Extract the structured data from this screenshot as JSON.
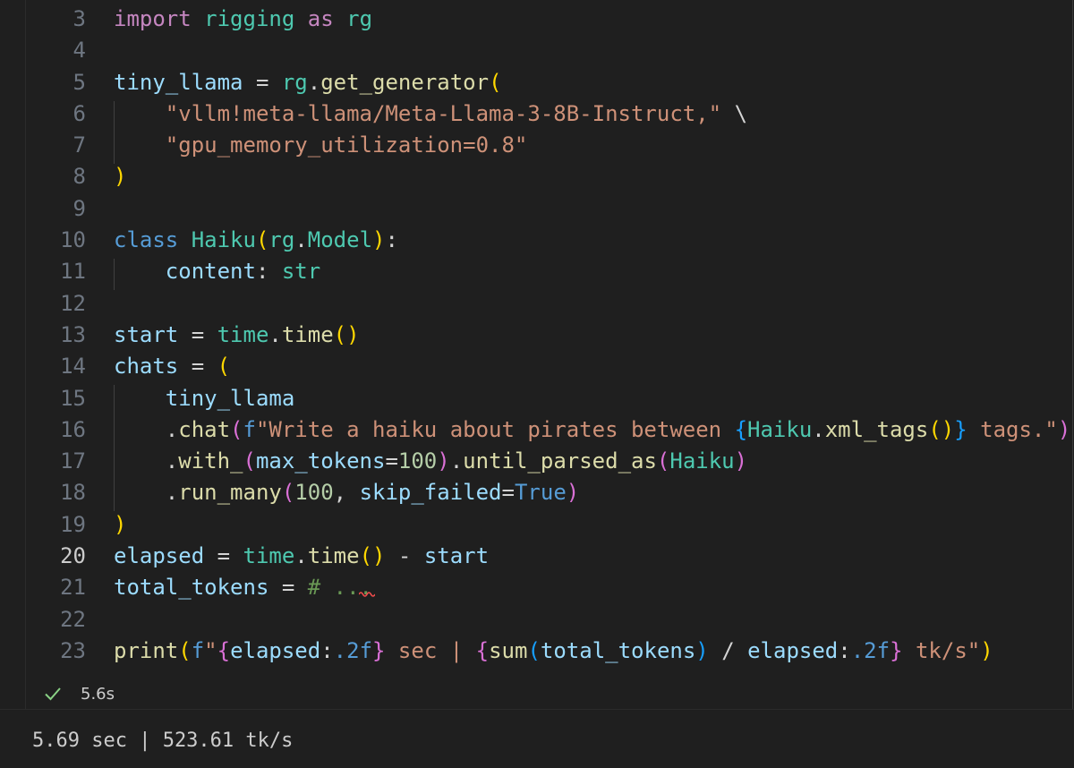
{
  "editor": {
    "line_numbers": [
      "3",
      "4",
      "5",
      "6",
      "7",
      "8",
      "9",
      "10",
      "11",
      "12",
      "13",
      "14",
      "15",
      "16",
      "17",
      "18",
      "19",
      "20",
      "21",
      "22",
      "23"
    ],
    "active_line": "20",
    "lines": [
      [
        [
          "kw",
          "import"
        ],
        [
          "op",
          " "
        ],
        [
          "cls",
          "rigging"
        ],
        [
          "op",
          " "
        ],
        [
          "kw",
          "as"
        ],
        [
          "op",
          " "
        ],
        [
          "cls",
          "rg"
        ]
      ],
      [],
      [
        [
          "var",
          "tiny_llama"
        ],
        [
          "op",
          " = "
        ],
        [
          "cls",
          "rg"
        ],
        [
          "op",
          "."
        ],
        [
          "fn",
          "get_generator"
        ],
        [
          "p1",
          "("
        ]
      ],
      [
        [
          "op",
          "    "
        ],
        [
          "str",
          "\"vllm!meta-llama/Meta-Llama-3-8B-Instruct,\""
        ],
        [
          "op",
          " \\"
        ]
      ],
      [
        [
          "op",
          "    "
        ],
        [
          "str",
          "\"gpu_memory_utilization=0.8\""
        ]
      ],
      [
        [
          "p1",
          ")"
        ]
      ],
      [],
      [
        [
          "kw2",
          "class"
        ],
        [
          "op",
          " "
        ],
        [
          "cls",
          "Haiku"
        ],
        [
          "p1",
          "("
        ],
        [
          "cls",
          "rg"
        ],
        [
          "op",
          "."
        ],
        [
          "cls",
          "Model"
        ],
        [
          "p1",
          ")"
        ],
        [
          "op",
          ":"
        ]
      ],
      [
        [
          "op",
          "    "
        ],
        [
          "var",
          "content"
        ],
        [
          "op",
          ": "
        ],
        [
          "cls",
          "str"
        ]
      ],
      [],
      [
        [
          "var",
          "start"
        ],
        [
          "op",
          " = "
        ],
        [
          "cls",
          "time"
        ],
        [
          "op",
          "."
        ],
        [
          "fn",
          "time"
        ],
        [
          "p1",
          "()"
        ]
      ],
      [
        [
          "var",
          "chats"
        ],
        [
          "op",
          " = "
        ],
        [
          "p1",
          "("
        ]
      ],
      [
        [
          "op",
          "    "
        ],
        [
          "var",
          "tiny_llama"
        ]
      ],
      [
        [
          "op",
          "    ."
        ],
        [
          "fn",
          "chat"
        ],
        [
          "p2",
          "("
        ],
        [
          "kw2",
          "f"
        ],
        [
          "str",
          "\"Write a haiku about pirates between "
        ],
        [
          "p3",
          "{"
        ],
        [
          "cls",
          "Haiku"
        ],
        [
          "op",
          "."
        ],
        [
          "fn",
          "xml_tags"
        ],
        [
          "p1",
          "()"
        ],
        [
          "p3",
          "}"
        ],
        [
          "str",
          " tags.\""
        ],
        [
          "p2",
          ")"
        ]
      ],
      [
        [
          "op",
          "    ."
        ],
        [
          "fn",
          "with_"
        ],
        [
          "p2",
          "("
        ],
        [
          "var",
          "max_tokens"
        ],
        [
          "op",
          "="
        ],
        [
          "num",
          "100"
        ],
        [
          "p2",
          ")"
        ],
        [
          "op",
          "."
        ],
        [
          "fn",
          "until_parsed_as"
        ],
        [
          "p2",
          "("
        ],
        [
          "cls",
          "Haiku"
        ],
        [
          "p2",
          ")"
        ]
      ],
      [
        [
          "op",
          "    ."
        ],
        [
          "fn",
          "run_many"
        ],
        [
          "p2",
          "("
        ],
        [
          "num",
          "100"
        ],
        [
          "op",
          ", "
        ],
        [
          "var",
          "skip_failed"
        ],
        [
          "op",
          "="
        ],
        [
          "kw2",
          "True"
        ],
        [
          "p2",
          ")"
        ]
      ],
      [
        [
          "p1",
          ")"
        ]
      ],
      [
        [
          "var",
          "elapsed"
        ],
        [
          "op",
          " = "
        ],
        [
          "cls",
          "time"
        ],
        [
          "op",
          "."
        ],
        [
          "fn",
          "time"
        ],
        [
          "p1",
          "()"
        ],
        [
          "op",
          " - "
        ],
        [
          "var",
          "start"
        ]
      ],
      [
        [
          "var",
          "total_tokens"
        ],
        [
          "op",
          " = "
        ],
        [
          "cm",
          "# ..."
        ]
      ],
      [],
      [
        [
          "fn",
          "print"
        ],
        [
          "p1",
          "("
        ],
        [
          "kw2",
          "f"
        ],
        [
          "str",
          "\""
        ],
        [
          "p2",
          "{"
        ],
        [
          "var",
          "elapsed"
        ],
        [
          "op",
          ":"
        ],
        [
          "kw2",
          ".2f"
        ],
        [
          "p2",
          "}"
        ],
        [
          "str",
          " sec | "
        ],
        [
          "p2",
          "{"
        ],
        [
          "fn",
          "sum"
        ],
        [
          "p3",
          "("
        ],
        [
          "var",
          "total_tokens"
        ],
        [
          "p3",
          ")"
        ],
        [
          "op",
          " / "
        ],
        [
          "var",
          "elapsed"
        ],
        [
          "op",
          ":"
        ],
        [
          "kw2",
          ".2f"
        ],
        [
          "p2",
          "}"
        ],
        [
          "str",
          " tk/s\""
        ],
        [
          "p1",
          ")"
        ]
      ]
    ]
  },
  "status": {
    "icon": "check-icon",
    "duration": "5.6s",
    "success_color": "#89d185"
  },
  "output": {
    "text": "5.69 sec | 523.61 tk/s"
  }
}
